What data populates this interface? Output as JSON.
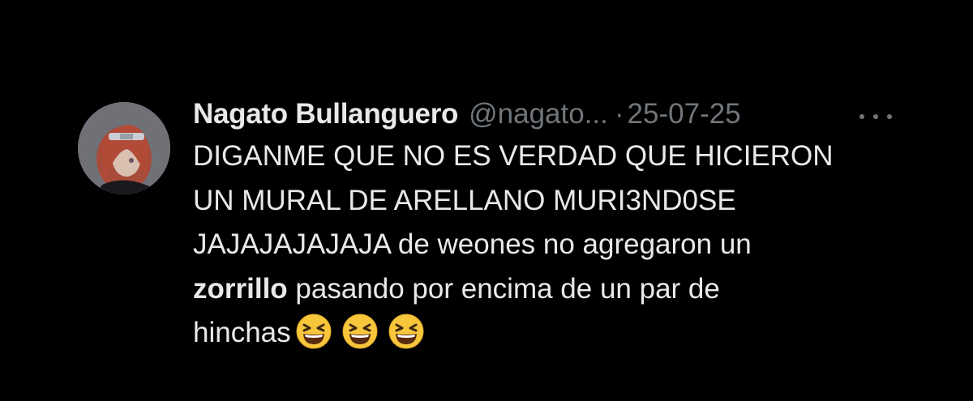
{
  "tweet": {
    "display_name": "Nagato Bullanguero",
    "handle": "@nagato...",
    "separator": "·",
    "date": "25-07-25",
    "more_icon": "more-horizontal-icon",
    "lines": [
      "DIGANME QUE NO ES VERDAD QUE HICIERON",
      "UN MURAL DE ARELLANO MURI3ND0SE",
      "JAJAJAJAJAJA de weones no agregaron un"
    ],
    "line4_bold": "zorrillo",
    "line4_rest": " pasando por encima de un par de",
    "line5_text": "hinchas",
    "emojis": [
      "grinning-squinting-face-emoji",
      "grinning-squinting-face-emoji",
      "grinning-squinting-face-emoji"
    ]
  },
  "colors": {
    "background": "#000000",
    "primary_text": "#e7e9ea",
    "secondary_text": "#71767b",
    "emoji_yellow": "#f7c63a"
  }
}
